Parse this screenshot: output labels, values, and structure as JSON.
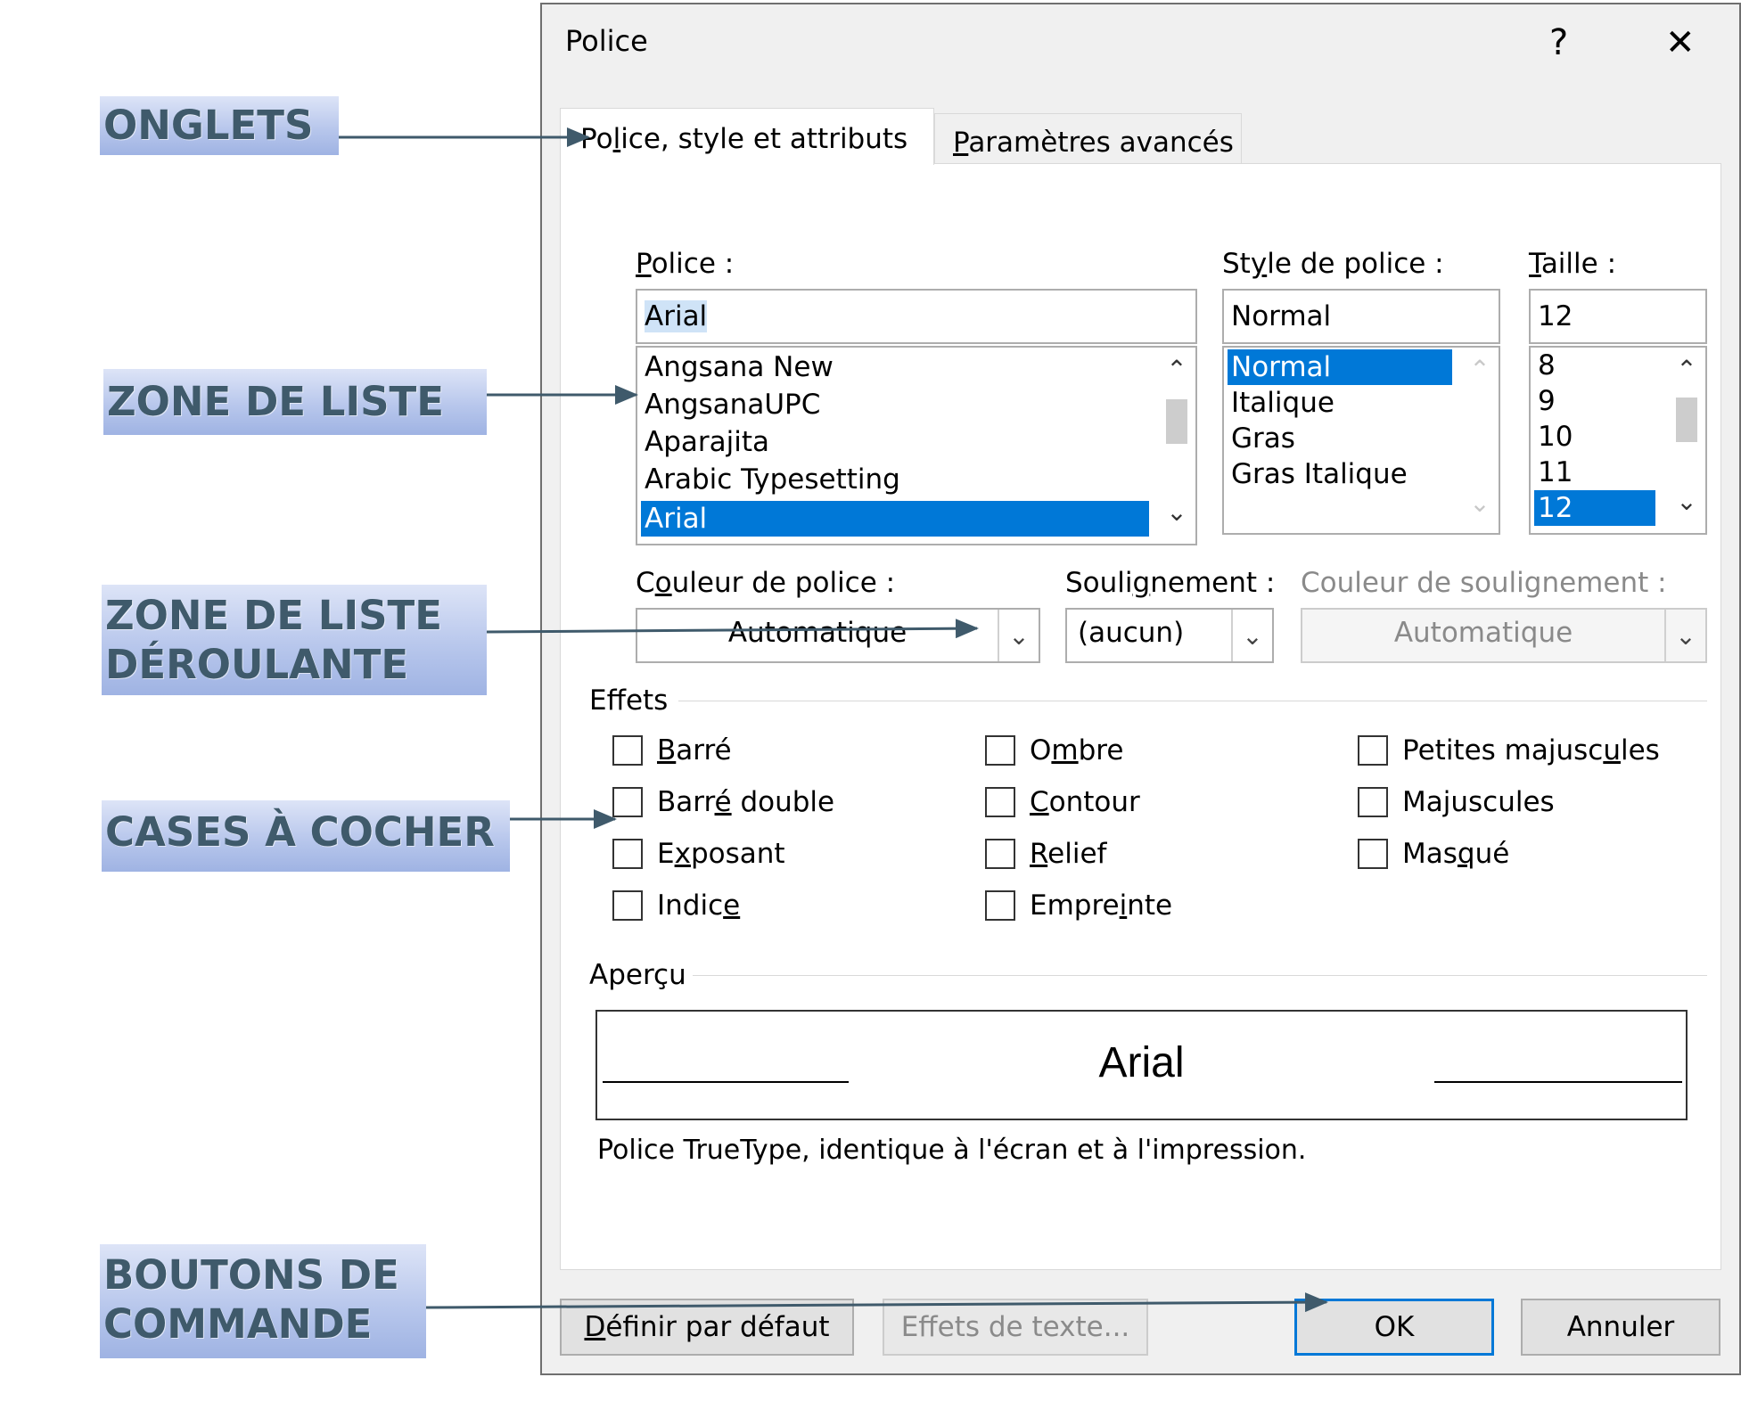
{
  "annotations": {
    "onglets": "ONGLETS",
    "zone_liste": "ZONE DE LISTE",
    "zone_liste_deroulante_l1": "ZONE DE LISTE",
    "zone_liste_deroulante_l2": "DÉROULANTE",
    "cases": "CASES À COCHER",
    "boutons_l1": "BOUTONS DE",
    "boutons_l2": "COMMANDE"
  },
  "dialog": {
    "title": "Police",
    "help": "?",
    "close": "✕",
    "tabs": [
      {
        "label_pre": "Po",
        "label_u": "l",
        "label_post": "ice, style et attributs",
        "active": true
      },
      {
        "label_pre": "",
        "label_u": "P",
        "label_post": "aramètres avancés",
        "active": false
      }
    ],
    "font": {
      "label_u": "P",
      "label_post": "olice  :",
      "value": "Arial",
      "list": [
        "Angsana New",
        "AngsanaUPC",
        "Aparajita",
        "Arabic Typesetting",
        "Arial"
      ],
      "selected": "Arial"
    },
    "style": {
      "label_pre": "St",
      "label_u": "y",
      "label_post": "le de police :",
      "value": "Normal",
      "list": [
        "Normal",
        "Italique",
        "Gras",
        "Gras Italique"
      ],
      "selected": "Normal"
    },
    "size": {
      "label_u": "T",
      "label_post": "aille :",
      "value": "12",
      "list": [
        "8",
        "9",
        "10",
        "11",
        "12"
      ],
      "selected": "12"
    },
    "font_color": {
      "label_pre": "C",
      "label_u": "o",
      "label_post": "uleur de police :",
      "value": "Automatique"
    },
    "underline": {
      "label_pre": "Souli",
      "label_u": "g",
      "label_post": "nement :",
      "value": "(aucun)"
    },
    "underline_color": {
      "label": "Couleur de soulignement :",
      "value": "Automatique"
    },
    "effects": {
      "title": "Effets",
      "col1": [
        {
          "pre": "",
          "u": "B",
          "post": "arré"
        },
        {
          "pre": "Barr",
          "u": "é",
          "post": " double"
        },
        {
          "pre": "E",
          "u": "x",
          "post": "posant"
        },
        {
          "pre": "Indic",
          "u": "e",
          "post": ""
        }
      ],
      "col2": [
        {
          "pre": "O",
          "u": "m",
          "post": "bre"
        },
        {
          "pre": "",
          "u": "C",
          "post": "ontour"
        },
        {
          "pre": "",
          "u": "R",
          "post": "elief"
        },
        {
          "pre": "Empre",
          "u": "i",
          "post": "nte"
        }
      ],
      "col3": [
        {
          "pre": "Petites majusc",
          "u": "u",
          "post": "les"
        },
        {
          "pre": "Ma",
          "u": "j",
          "post": "uscules"
        },
        {
          "pre": "Mas",
          "u": "q",
          "post": "ué"
        }
      ]
    },
    "preview": {
      "title": "Aperçu",
      "sample": "Arial",
      "description": "Police TrueType, identique à l'écran et à l'impression."
    },
    "buttons": {
      "default": {
        "pre": "",
        "u": "D",
        "post": "éfinir par défaut"
      },
      "text_effects": "Effets de texte...",
      "ok": "OK",
      "cancel": "Annuler"
    }
  }
}
